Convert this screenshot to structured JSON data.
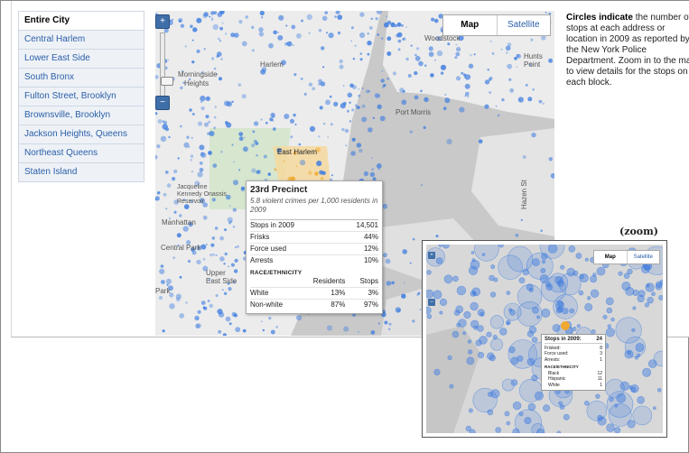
{
  "sidebar": {
    "items": [
      {
        "label": "Entire City",
        "selected": true
      },
      {
        "label": "Central Harlem"
      },
      {
        "label": "Lower East Side"
      },
      {
        "label": "South Bronx"
      },
      {
        "label": "Fulton Street, Brooklyn"
      },
      {
        "label": "Brownsville, Brooklyn"
      },
      {
        "label": "Jackson Heights, Queens"
      },
      {
        "label": "Northeast Queens"
      },
      {
        "label": "Staten Island"
      }
    ]
  },
  "map": {
    "type_buttons": {
      "map": "Map",
      "satellite": "Satellite"
    },
    "labels": {
      "morningside": "Morningside",
      "heights": "Heights",
      "harlem": "Harlem",
      "east_harlem": "East Harlem",
      "manhattan": "Manhattan",
      "central_park": "Central Park",
      "upper_east_side": "Upper East Side",
      "park": "Park",
      "port_morris": "Port Morris",
      "woodstock": "Woodstock",
      "hunts_point": "Hunts Point",
      "hazen_st": "Hazen St",
      "jacqueline": "Jacqueline Kennedy Onassis Reservoir"
    },
    "popup": {
      "title": "23rd Precinct",
      "subtitle": "5.8 violent crimes per 1,000 residents in 2009",
      "rows": [
        {
          "label": "Stops in 2009",
          "value": "14,501"
        },
        {
          "label": "Frisks",
          "value": "44%"
        },
        {
          "label": "Force used",
          "value": "12%"
        },
        {
          "label": "Arrests",
          "value": "10%"
        }
      ],
      "ethnicity_heading": "RACE/ETHNICITY",
      "col_residents": "Residents",
      "col_stops": "Stops",
      "ethnicity": [
        {
          "label": "White",
          "residents": "13%",
          "stops": "3%"
        },
        {
          "label": "Non-white",
          "residents": "87%",
          "stops": "97%"
        }
      ]
    }
  },
  "info": {
    "bold": "Circles indicate",
    "lines": [
      " the number of",
      "stops at each address or",
      "location in 2009 as reported by",
      "the New York Police",
      "Department. Zoom in to the map",
      "to view details for the stops on",
      "each block."
    ]
  },
  "zoom_label": "(zoom)",
  "inset": {
    "type_buttons": {
      "map": "Map",
      "satellite": "Satellite"
    },
    "popup": {
      "title": "Stops in 2009:",
      "title_value": "24",
      "rows": [
        {
          "label": "Frisked:",
          "value": "8"
        },
        {
          "label": "Force used:",
          "value": "3"
        },
        {
          "label": "Arrests:",
          "value": "1"
        }
      ],
      "ethnicity_heading": "RACE/ETHNICITY",
      "ethnicity": [
        {
          "label": "Black",
          "value": "12"
        },
        {
          "label": "Hispanic",
          "value": "11"
        },
        {
          "label": "White",
          "value": "1"
        }
      ]
    }
  },
  "colors": {
    "dot": "#3b7be0",
    "highlight": "#f0a830",
    "water": "#c9c9c9",
    "land": "#ececec",
    "link": "#2a5ea8"
  }
}
